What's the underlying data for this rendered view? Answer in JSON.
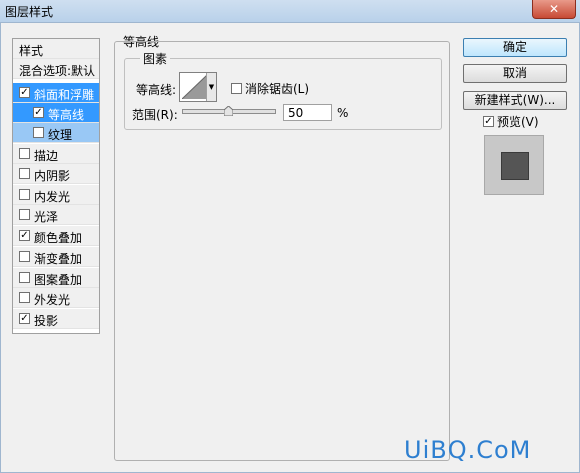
{
  "window": {
    "title": "图层样式",
    "close_label": "✕"
  },
  "styles_list": {
    "items": [
      {
        "label": "样式",
        "type": "header"
      },
      {
        "label": "混合选项:默认",
        "type": "header"
      },
      {
        "label": "斜面和浮雕",
        "checked": true,
        "state": "selected"
      },
      {
        "label": "等高线",
        "checked": true,
        "state": "selected-sub"
      },
      {
        "label": "纹理",
        "checked": false,
        "state": "sub"
      },
      {
        "label": "描边",
        "checked": false
      },
      {
        "label": "内阴影",
        "checked": false
      },
      {
        "label": "内发光",
        "checked": false
      },
      {
        "label": "光泽",
        "checked": false
      },
      {
        "label": "颜色叠加",
        "checked": true
      },
      {
        "label": "渐变叠加",
        "checked": false
      },
      {
        "label": "图案叠加",
        "checked": false
      },
      {
        "label": "外发光",
        "checked": false
      },
      {
        "label": "投影",
        "checked": true
      }
    ]
  },
  "panel": {
    "title": "等高线",
    "group_title": "图素",
    "contour_label": "等高线:",
    "anti_alias_label": "消除锯齿(L)",
    "anti_alias_checked": false,
    "range_label": "范围(R):",
    "range_value": "50",
    "range_unit": "%",
    "range_slider_fraction": 0.5
  },
  "buttons": {
    "ok": "确定",
    "cancel": "取消",
    "new_style": "新建样式(W)...",
    "preview_label": "预览(V)",
    "preview_checked": true
  },
  "watermark": "UiBQ.CoM",
  "check_glyph": "✓"
}
